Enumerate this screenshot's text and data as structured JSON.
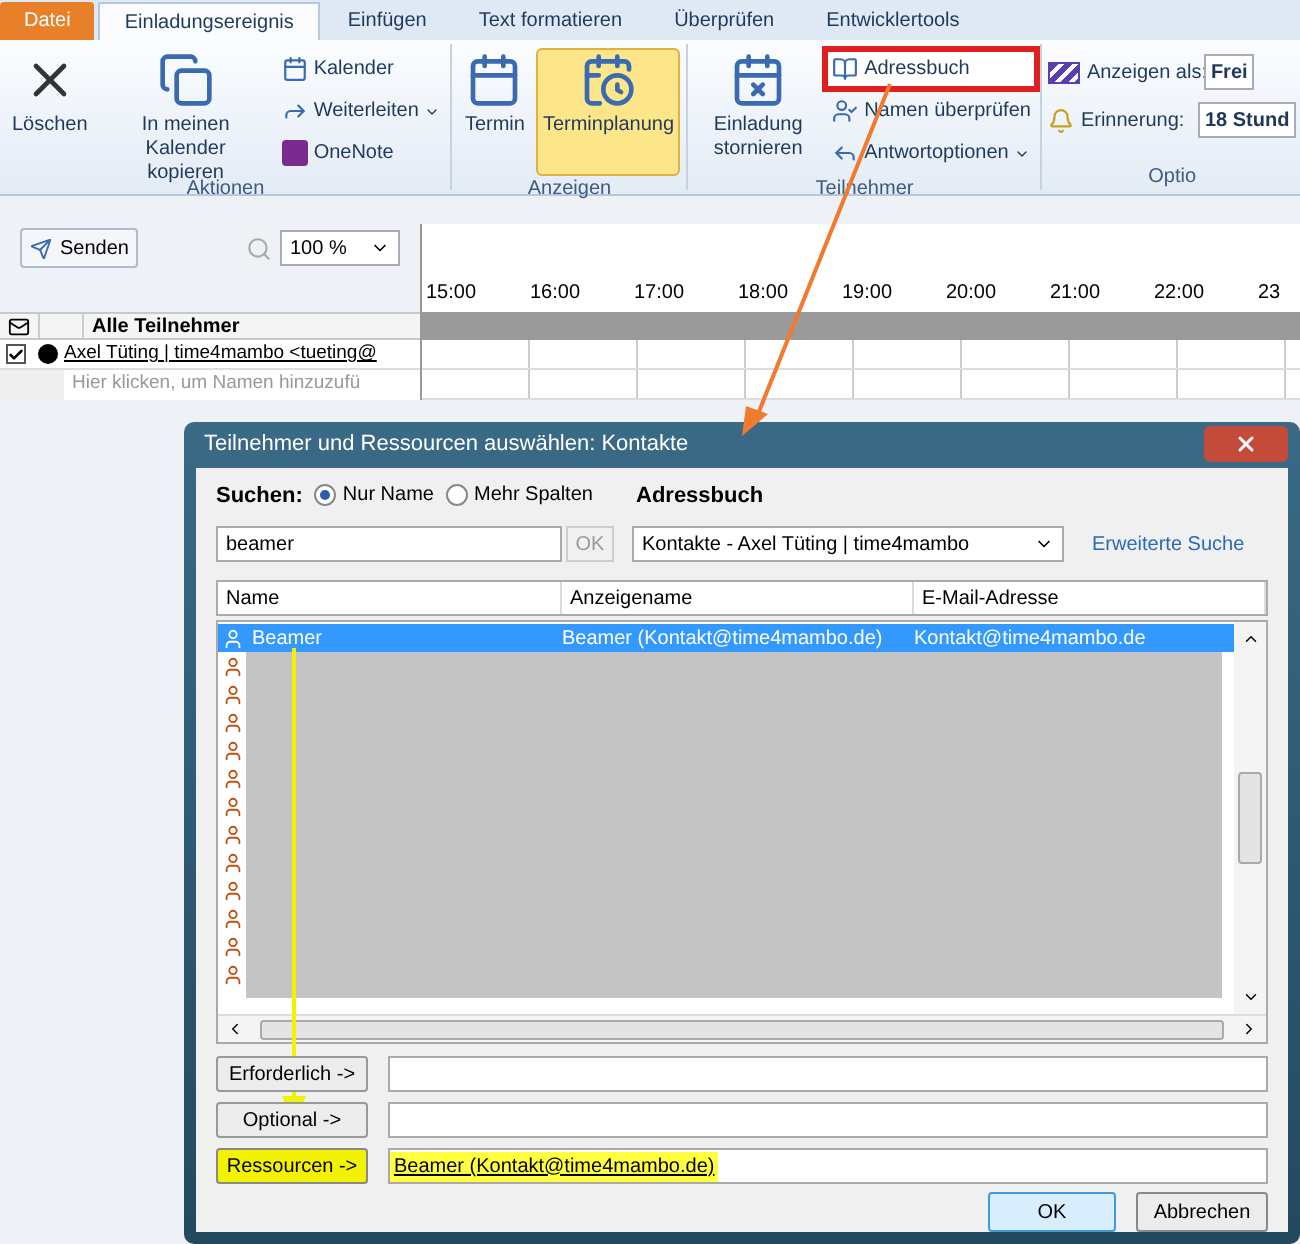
{
  "ribbon": {
    "tabs": [
      {
        "label": "Datei",
        "kind": "file",
        "selected": false
      },
      {
        "label": "Einladungsereignis",
        "kind": "tab",
        "selected": true
      },
      {
        "label": "Einfügen",
        "kind": "tab",
        "selected": false
      },
      {
        "label": "Text formatieren",
        "kind": "tab",
        "selected": false
      },
      {
        "label": "Überprüfen",
        "kind": "tab",
        "selected": false
      },
      {
        "label": "Entwicklertools",
        "kind": "tab",
        "selected": false
      }
    ],
    "groups": [
      {
        "label": "Aktionen",
        "items": [
          {
            "kind": "large",
            "label": "Löschen",
            "selected": false
          },
          {
            "kind": "large",
            "label": "In meinen Kalender kopieren",
            "selected": false
          },
          {
            "kind": "stack",
            "entries": [
              {
                "label": "Kalender",
                "dropdown": false,
                "highlighted": false
              },
              {
                "label": "Weiterleiten",
                "dropdown": true,
                "highlighted": false
              },
              {
                "label": "OneNote",
                "dropdown": false,
                "highlighted": false
              }
            ]
          }
        ]
      },
      {
        "label": "Anzeigen",
        "items": [
          {
            "kind": "large",
            "label": "Termin",
            "selected": false
          },
          {
            "kind": "large",
            "label": "Terminplanung",
            "selected": true
          }
        ]
      },
      {
        "label": "Teilnehmer",
        "items": [
          {
            "kind": "large",
            "label": "Einladung stornieren",
            "selected": false
          },
          {
            "kind": "stack",
            "entries": [
              {
                "label": "Adressbuch",
                "dropdown": false,
                "highlighted": true
              },
              {
                "label": "Namen überprüfen",
                "dropdown": false,
                "highlighted": false
              },
              {
                "label": "Antwortoptionen",
                "dropdown": true,
                "highlighted": false
              }
            ]
          }
        ]
      },
      {
        "label": "Optio",
        "items": [
          {
            "kind": "fields",
            "entries": [
              {
                "label": "Anzeigen als:",
                "value": "Frei"
              },
              {
                "label": "Erinnerung:",
                "value": "18 Stund"
              }
            ]
          }
        ]
      }
    ]
  },
  "scheduler": {
    "send_button": "Senden",
    "zoom": "100 %",
    "hours": [
      "15:00",
      "16:00",
      "17:00",
      "18:00",
      "19:00",
      "20:00",
      "21:00",
      "22:00",
      "23"
    ],
    "attendees_header": "Alle Teilnehmer",
    "attendees": [
      {
        "name": "Axel Tüting | time4mambo <tueting@",
        "checked": true
      }
    ],
    "add_placeholder": "Hier klicken, um Namen hinzuzufü"
  },
  "dialog": {
    "title": "Teilnehmer und Ressourcen auswählen: Kontakte",
    "search_label": "Suchen:",
    "search_modes": [
      {
        "label": "Nur Name",
        "selected": true
      },
      {
        "label": "Mehr Spalten",
        "selected": false
      }
    ],
    "address_book_label": "Adressbuch",
    "search_value": "beamer",
    "ok_button": "OK",
    "address_book_value": "Kontakte - Axel Tüting | time4mambo",
    "advanced_search": "Erweiterte Suche",
    "columns": [
      "Name",
      "Anzeigename",
      "E-Mail-Adresse"
    ],
    "rows": [
      {
        "name": "Beamer",
        "display": "Beamer (Kontakt@time4mambo.de)",
        "email": "Kontakt@time4mambo.de",
        "selected": true
      }
    ],
    "fields": [
      {
        "button": "Erforderlich ->",
        "highlighted": false
      },
      {
        "button": "Optional ->",
        "highlighted": false
      },
      {
        "button": "Ressourcen ->",
        "value": "Beamer (Kontakt@time4mambo.de)",
        "highlighted": true
      }
    ],
    "buttons": [
      "OK",
      "Abbrechen"
    ]
  }
}
